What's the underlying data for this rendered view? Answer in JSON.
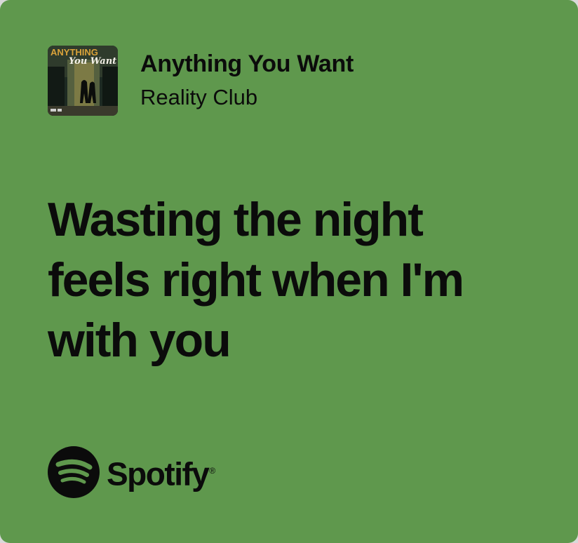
{
  "track": {
    "title": "Anything You Want",
    "artist": "Reality Club"
  },
  "album_art": {
    "text_top": "ANYTHING",
    "text_script": "You Want"
  },
  "lyrics": {
    "lines": [
      "Wasting the night",
      "feels right when I'm",
      "with you"
    ]
  },
  "brand": {
    "name": "Spotify",
    "trademark": "®"
  },
  "colors": {
    "card_background": "#5f984d",
    "text": "#0b0b0b"
  }
}
